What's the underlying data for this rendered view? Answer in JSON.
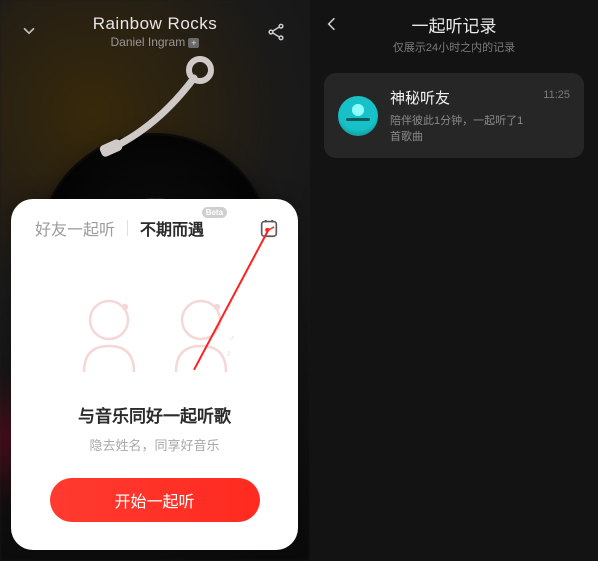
{
  "left": {
    "song_title": "Rainbow Rocks",
    "artist": "Daniel Ingram",
    "tabs": {
      "friends": "好友一起听",
      "random": "不期而遇",
      "beta": "Beta"
    },
    "promo": {
      "title": "与音乐同好一起听歌",
      "subtitle": "隐去姓名，同享好音乐"
    },
    "start_button": "开始一起听"
  },
  "right": {
    "title": "一起听记录",
    "subtitle": "仅展示24小时之内的记录",
    "record": {
      "name": "神秘听友",
      "detail": "陪伴彼此1分钟，一起听了1首歌曲",
      "time": "11:25"
    }
  }
}
